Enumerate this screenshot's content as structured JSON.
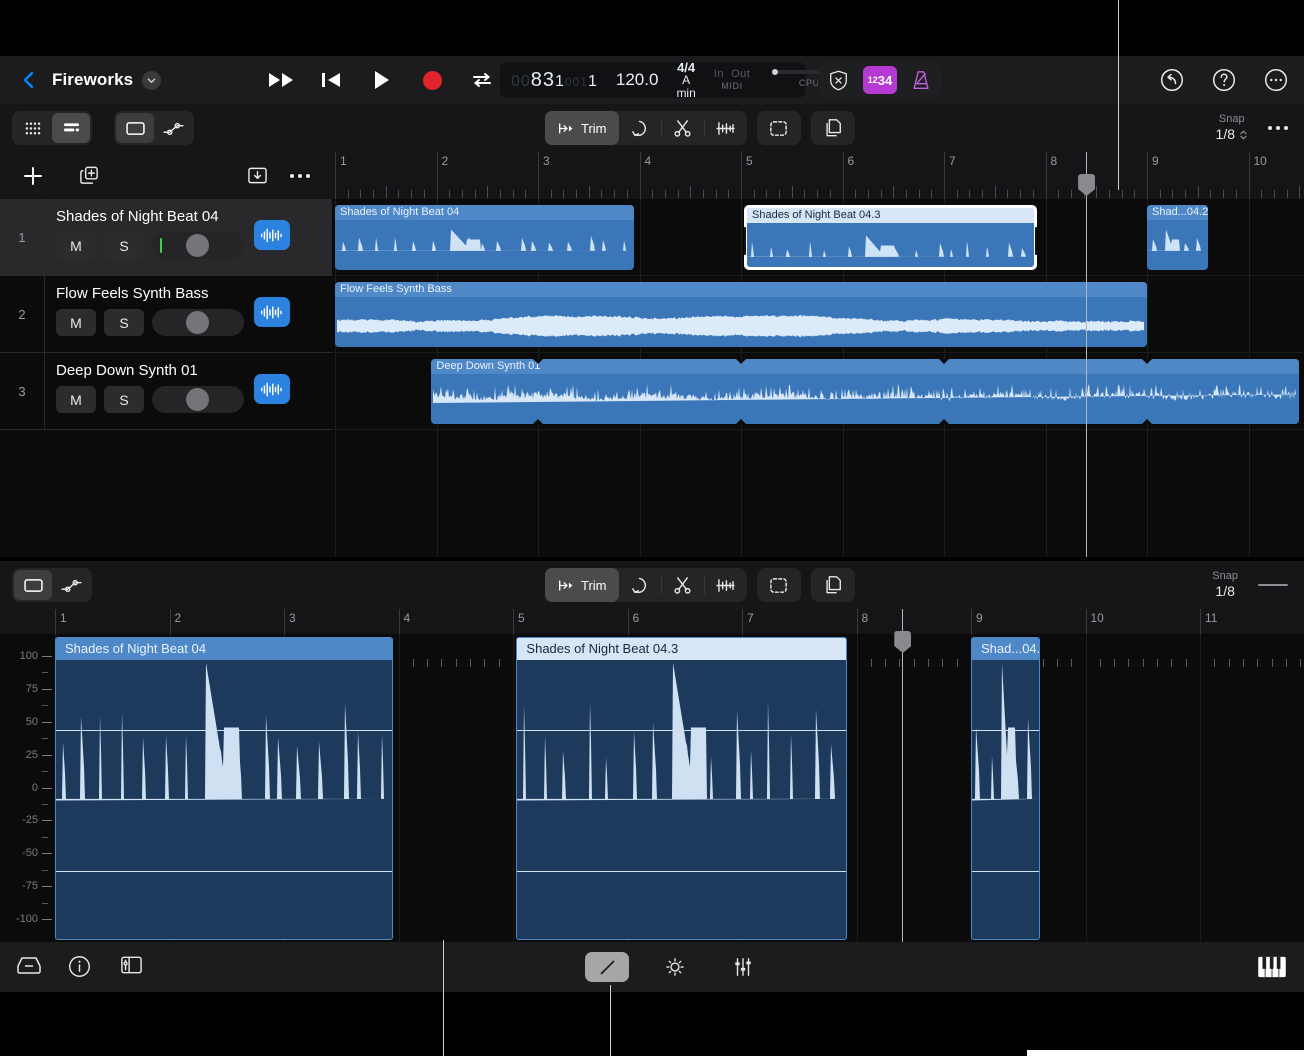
{
  "header": {
    "back_icon": "chevron-left-icon",
    "project_title": "Fireworks",
    "caret_icon": "chevron-down-icon",
    "transport": {
      "fast_forward": "fast-forward-icon",
      "rewind": "rewind-to-start-icon",
      "play": "play-icon",
      "record": "record-icon",
      "cycle": "cycle-icon"
    },
    "lcd": {
      "position_dim_1": "00",
      "position_bar": "8",
      "position_beat": "3",
      "position_div": "1",
      "position_dim_2": "001",
      "position_ticks": "1",
      "tempo": "120.0",
      "time_signature": "4/4",
      "key": "A min",
      "midi_in": "In",
      "midi_out": "Out",
      "midi_label": "MIDI",
      "cpu_label": "CPU"
    },
    "lcd_right": {
      "bypass_icon": "bypass-shield-icon",
      "count_in_small": "12",
      "count_in_large": "34",
      "metronome_icon": "metronome-icon"
    },
    "right_icons": [
      {
        "name": "undo-icon"
      },
      {
        "name": "help-icon"
      },
      {
        "name": "more-icon"
      }
    ]
  },
  "toolbar": {
    "view_segments": [
      {
        "name": "grid-view-icon",
        "active": false
      },
      {
        "name": "list-view-icon",
        "active": true
      }
    ],
    "mode_segments": [
      {
        "name": "region-mode-icon",
        "active": true
      },
      {
        "name": "automation-mode-icon",
        "active": false
      }
    ],
    "tools": [
      {
        "name": "trim-tool",
        "label": "Trim",
        "active": true
      },
      {
        "name": "loop-tool",
        "label": "",
        "active": false
      },
      {
        "name": "split-tool",
        "label": "",
        "active": false
      },
      {
        "name": "fade-tool",
        "label": "",
        "active": false
      }
    ],
    "extra_tools": [
      {
        "name": "marquee-tool",
        "label": ""
      },
      {
        "name": "duplicate-tool",
        "label": ""
      }
    ],
    "snap_label": "Snap",
    "snap_value": "1/8",
    "more_label": "more-options"
  },
  "tracks_panel": {
    "add_track_icon": "add-track-icon",
    "duplicate_track_icon": "duplicate-track-icon",
    "import_icon": "import-icon",
    "more_icon": "track-more-icon",
    "mute_label": "M",
    "solo_label": "S",
    "tracks": [
      {
        "number": "1",
        "name": "Shades of Night Beat 04",
        "selected": true,
        "has_meter": true
      },
      {
        "number": "2",
        "name": "Flow Feels Synth Bass",
        "selected": false,
        "has_meter": false
      },
      {
        "number": "3",
        "name": "Deep Down Synth 01",
        "selected": false,
        "has_meter": false
      }
    ]
  },
  "arrange": {
    "ruler_bars": [
      "1",
      "2",
      "3",
      "4",
      "5",
      "6",
      "7",
      "8",
      "9",
      "10"
    ],
    "playhead_position": "8.4",
    "regions": [
      {
        "track": 1,
        "name": "Shades of Night Beat 04",
        "selected": false,
        "start_bar": 1,
        "end_bar": 3.95
      },
      {
        "track": 1,
        "name": "Shades of Night Beat 04.3",
        "selected": true,
        "start_bar": 5.03,
        "end_bar": 7.92
      },
      {
        "track": 1,
        "name": "Shad...04.2",
        "selected": false,
        "start_bar": 9.0,
        "end_bar": 9.6
      },
      {
        "track": 2,
        "name": "Flow Feels Synth Bass",
        "selected": false,
        "start_bar": 1,
        "end_bar": 9.0
      },
      {
        "track": 3,
        "name": "Deep Down Synth 01",
        "selected": false,
        "start_bar": 1.95,
        "end_bar": 10.5
      }
    ]
  },
  "editor": {
    "mode_segments": [
      {
        "name": "region-mode-icon",
        "active": true
      },
      {
        "name": "automation-mode-icon",
        "active": false
      }
    ],
    "tools": [
      {
        "name": "trim-tool",
        "label": "Trim",
        "active": true
      },
      {
        "name": "loop-tool",
        "label": "",
        "active": false
      },
      {
        "name": "split-tool",
        "label": "",
        "active": false
      },
      {
        "name": "fade-tool",
        "label": "",
        "active": false
      }
    ],
    "extra_tools": [
      {
        "name": "marquee-tool",
        "label": ""
      },
      {
        "name": "duplicate-tool",
        "label": ""
      }
    ],
    "snap_label": "Snap",
    "snap_value": "1/8",
    "resize_handle": "resize-handle",
    "amplitude_axis": [
      "100",
      "75",
      "50",
      "25",
      "0",
      "-25",
      "-50",
      "-75",
      "-100"
    ],
    "ruler_bars": [
      "1",
      "2",
      "3",
      "4",
      "5",
      "6",
      "7",
      "8",
      "9",
      "10",
      "11"
    ],
    "playhead_position": "8.4",
    "regions": [
      {
        "name": "Shades of Night Beat 04",
        "selected": false,
        "start_bar": 1,
        "end_bar": 3.95
      },
      {
        "name": "Shades of Night Beat 04.3",
        "selected": true,
        "start_bar": 5.03,
        "end_bar": 7.92
      },
      {
        "name": "Shad...04.2",
        "selected": false,
        "start_bar": 9.0,
        "end_bar": 9.6
      }
    ]
  },
  "bottom_bar": {
    "left_icons": [
      {
        "name": "library-icon"
      },
      {
        "name": "info-icon"
      },
      {
        "name": "inspector-icon"
      }
    ],
    "center_tools": [
      {
        "name": "pencil-tool",
        "active": true
      },
      {
        "name": "gain-tool",
        "active": false
      },
      {
        "name": "faders-tool",
        "active": false
      }
    ],
    "right_icon": {
      "name": "keyboard-icon"
    }
  },
  "colors": {
    "accent_blue": "#2b82e0",
    "region_blue": "#3b76b8",
    "region_title_blue": "#4f88c6",
    "record_red": "#e0242b",
    "count_in_purple": "#b53ad1",
    "meter_green": "#3dd24a",
    "editor_region_bg": "#1d3a5c"
  }
}
